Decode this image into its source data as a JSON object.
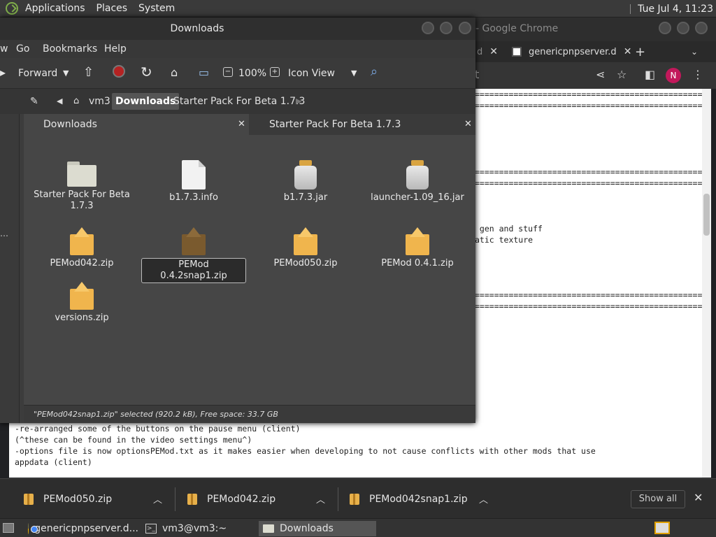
{
  "top_panel": {
    "menu": [
      "Applications",
      "Places",
      "System"
    ],
    "clock": "Tue Jul  4, 11:23"
  },
  "chrome": {
    "title": "- Google Chrome",
    "tab_partial": "d",
    "tab_label": "genericpnpserver.d",
    "new_tab": "+",
    "toolbar_left_text": "t",
    "avatar_letter": "N",
    "page_lines": [
      "=====================================================",
      "=====================================================",
      "=====================================================",
      "=====================================================",
      " gen and stuff",
      "atic texture",
      "=====================================================",
      "====================================================="
    ],
    "page_bottom_lines": [
      "-re-arranged some of the buttons on the pause menu (client)",
      "(^these can be found in the video settings menu^)",
      "-options file is now optionsPEMod.txt as it makes easier when developing to not cause conflicts with other mods that use",
      "appdata (client)"
    ],
    "downloads": [
      {
        "name": "PEMod050.zip"
      },
      {
        "name": "PEMod042.zip"
      },
      {
        "name": "PEMod042snap1.zip"
      }
    ],
    "show_all": "Show all"
  },
  "file_manager": {
    "title": "Downloads",
    "menu": [
      "w",
      "Go",
      "Bookmarks",
      "Help"
    ],
    "toolbar": {
      "forward": "Forward",
      "zoom": "100%",
      "view_mode": "Icon View"
    },
    "breadcrumbs": [
      "vm3",
      "Downloads",
      "Starter Pack For Beta 1.7.3"
    ],
    "tabs": [
      {
        "label": "Downloads"
      },
      {
        "label": "Starter Pack For Beta 1.7.3"
      }
    ],
    "items": [
      {
        "name": "Starter Pack For Beta 1.7.3",
        "type": "folder"
      },
      {
        "name": "b1.7.3.info",
        "type": "file"
      },
      {
        "name": "b1.7.3.jar",
        "type": "jar"
      },
      {
        "name": "launcher-1.09_16.jar",
        "type": "jar"
      },
      {
        "name": "PEMod042.zip",
        "type": "zip"
      },
      {
        "name": "PEMod 0.4.2snap1.zip",
        "type": "zip",
        "selected": true
      },
      {
        "name": "PEMod050.zip",
        "type": "zip"
      },
      {
        "name": "PEMod 0.4.1.zip",
        "type": "zip"
      },
      {
        "name": "versions.zip",
        "type": "zip"
      }
    ],
    "status": "\"PEMod042snap1.zip\" selected (920.2 kB), Free space: 33.7 GB"
  },
  "taskbar": {
    "tasks": [
      {
        "label": "genericpnpserver.d..."
      },
      {
        "label": "vm3@vm3:~"
      },
      {
        "label": "Downloads"
      }
    ]
  }
}
